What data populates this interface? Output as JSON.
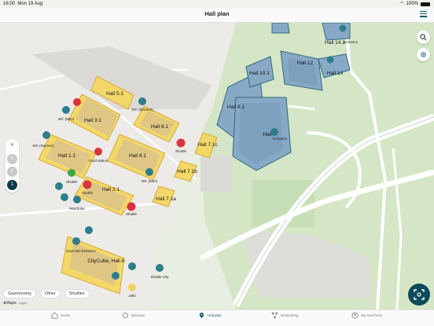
{
  "status_bar": {
    "time": "16:00",
    "date": "Mon 19 Aug",
    "battery": "100%"
  },
  "header": {
    "title": "Hall plan"
  },
  "halls": {
    "h5_1": "Hall 5.1",
    "h3_1": "Hall 3.1",
    "h6_1": "Hall 6.1",
    "h1_1": "Hall 1.1",
    "h4_1": "Hall 4.1",
    "h2_1": "Hall 2.1",
    "h7_1c": "Hall 7.1c",
    "h7_1b": "Hall 7.1b",
    "h7_1a": "Hall 7.1a",
    "h8_1": "Hall 8.1",
    "h10_1": "Hall 10.1",
    "h12": "Hall 12",
    "h13": "Hall 13",
    "h14_1": "Hall 14.1",
    "h9": "Hall",
    "cube": "CityCube, Hall A"
  },
  "pois": {
    "wc_men_1": "WC (Men)",
    "wc_women_1": "WC (Women)",
    "wc_women_2": "WC (Women)",
    "wc_men_2": "WC (Men)",
    "shuttle_1": "Shuttle",
    "shuttle_2": "Shuttle",
    "shuttle_3": "Shuttle",
    "shuttle_4": "Shuttle",
    "food": "Food station",
    "wardrobe": "Wardrobe",
    "cube_entrance": "CityCube Entrance",
    "shuttle_city": "Shuttle City",
    "jelbi": "Jelbi",
    "entrance_1": "Entrance",
    "entrance_2": "Entrance"
  },
  "floors": [
    "1",
    "2",
    "1"
  ],
  "filters": [
    "Gastronomy",
    "Other",
    "Shuttles"
  ],
  "maps_credit": {
    "brand": "Maps",
    "legal": "Legal"
  },
  "tabs": [
    {
      "label": "Home"
    },
    {
      "label": "Discover"
    },
    {
      "label": "Hall plan"
    },
    {
      "label": "Networking"
    },
    {
      "label": "My InnoTrans"
    }
  ],
  "colors": {
    "accent": "#1a5a6c",
    "hall_yellow": "#f2d35a",
    "hall_blue": "#7fa3c3",
    "marker_red": "#d9333f",
    "marker_teal": "#2e7d8c"
  }
}
